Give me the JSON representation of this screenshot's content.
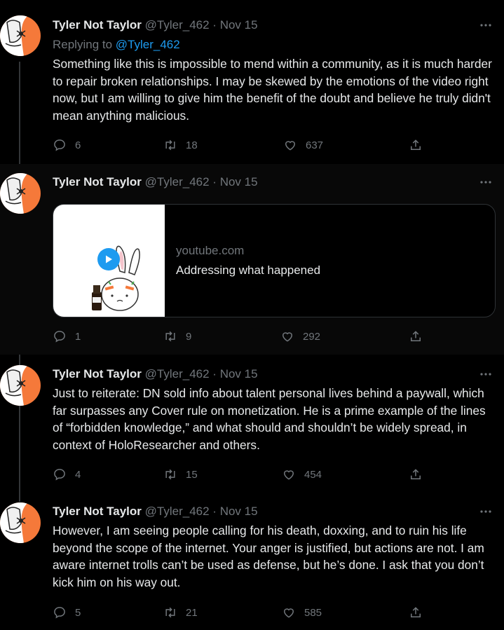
{
  "tweets": [
    {
      "name": "Tyler Not Taylor",
      "handle": "@Tyler_462",
      "sep": "·",
      "date": "Nov 15",
      "replying_prefix": "Replying to ",
      "replying_handle": "@Tyler_462",
      "text": "Something like this is impossible to mend within a community, as it is much harder to repair broken relationships. I may be skewed by the emotions of the video right now, but I am willing to give him the benefit of the doubt and believe he truly didn't mean anything malicious.",
      "replies": "6",
      "retweets": "18",
      "likes": "637"
    },
    {
      "name": "Tyler Not Taylor",
      "handle": "@Tyler_462",
      "sep": "·",
      "date": "Nov 15",
      "card": {
        "domain": "youtube.com",
        "title": "Addressing what happened"
      },
      "replies": "1",
      "retweets": "9",
      "likes": "292"
    },
    {
      "name": "Tyler Not Taylor",
      "handle": "@Tyler_462",
      "sep": "·",
      "date": "Nov 15",
      "text": "Just to reiterate: DN sold info about talent personal lives behind a paywall, which far surpasses any Cover rule on monetization. He is a prime example of the lines of “forbidden knowledge,” and what should and shouldn’t be widely spread, in context of HoloResearcher and others.",
      "replies": "4",
      "retweets": "15",
      "likes": "454"
    },
    {
      "name": "Tyler Not Taylor",
      "handle": "@Tyler_462",
      "sep": "·",
      "date": "Nov 15",
      "text": "However, I am seeing people calling for his death, doxxing, and to ruin his life beyond the scope of the internet. Your anger is justified, but actions are not. I am aware internet trolls can’t be used as defense, but he’s done. I ask that you don’t kick him on his way out.",
      "replies": "5",
      "retweets": "21",
      "likes": "585"
    }
  ],
  "icons": {
    "reply": "speech-bubble-icon",
    "retweet": "retweet-arrows-icon",
    "like": "heart-icon",
    "share": "share-upload-icon",
    "more": "ellipsis-icon",
    "play": "play-icon"
  },
  "colors": {
    "background": "#000000",
    "text": "#e7e9ea",
    "muted": "#71767b",
    "link": "#1d9bf0",
    "avatar_accent": "#f5793a",
    "thread_line": "#333639"
  }
}
